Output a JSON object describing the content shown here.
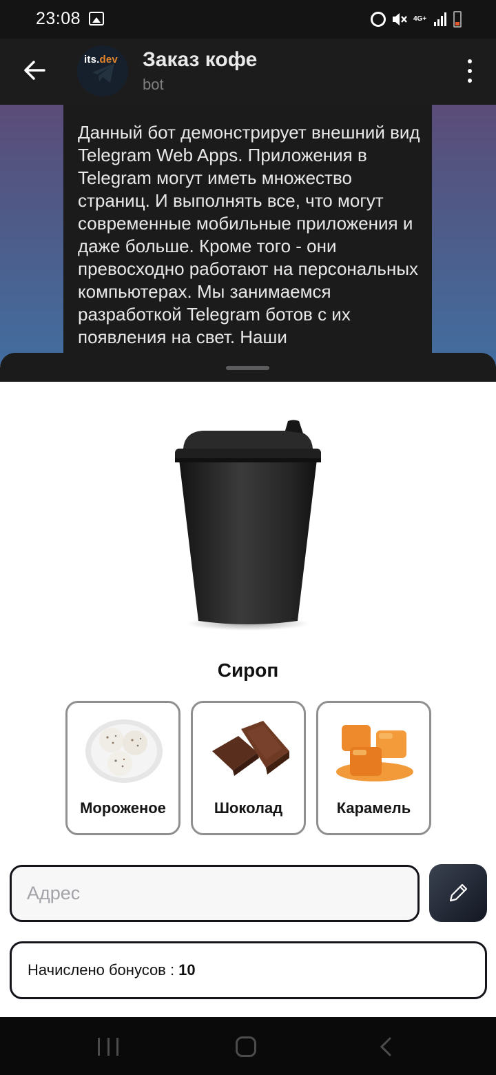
{
  "status_bar": {
    "time": "23:08",
    "network_label": "4G+",
    "icons": [
      "image-icon",
      "alarm-icon",
      "mute-icon",
      "signal-icon",
      "battery-icon"
    ]
  },
  "header": {
    "title": "Заказ кофе",
    "subtitle": "bot",
    "avatar_logo_main": "its.",
    "avatar_logo_accent": "dev"
  },
  "message": {
    "text": "Данный бот демонстрирует внешний вид Telegram Web Apps. Приложения в Telegram могут иметь множество страниц. И выполнять все, что могут современные мобильные приложения и даже больше. Кроме того - они превосходно работают на персональных компьютерах. Мы занимаемся разработкой Telegram ботов с их появления на свет. Наши"
  },
  "app": {
    "section_title": "Сироп",
    "syrups": [
      {
        "label": "Мороженое",
        "icon": "ice-cream-icon"
      },
      {
        "label": "Шоколад",
        "icon": "chocolate-icon"
      },
      {
        "label": "Карамель",
        "icon": "caramel-icon"
      }
    ],
    "address_placeholder": "Адрес",
    "address_value": "",
    "bonus_label": "Начислено бонусов :",
    "bonus_value": "10"
  },
  "colors": {
    "accent_dark": "#13131a",
    "caramel": "#e4852b",
    "chat_bg_top": "#5b4c79",
    "chat_bg_bottom": "#426ea0"
  }
}
